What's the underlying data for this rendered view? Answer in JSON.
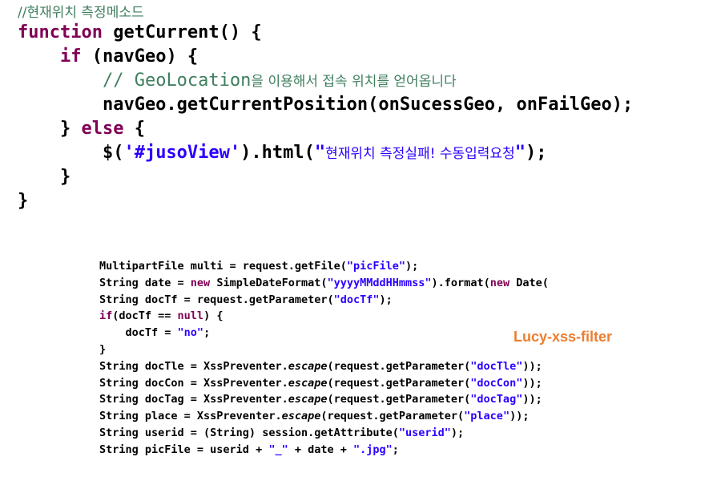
{
  "colors": {
    "keyword": "#7f0055",
    "string": "#2a00ff",
    "comment": "#3f7f5f",
    "plain": "#000000",
    "label": "#ed7d31"
  },
  "geo_code": {
    "lines": [
      [
        {
          "t": "comment",
          "v": "//현재위치 측정메소드"
        }
      ],
      [
        {
          "t": "keyword",
          "v": "function"
        },
        {
          "t": "plain",
          "v": " getCurrent() {"
        }
      ],
      [
        {
          "t": "plain",
          "v": "    "
        },
        {
          "t": "keyword",
          "v": "if"
        },
        {
          "t": "plain",
          "v": " (navGeo) {"
        }
      ],
      [
        {
          "t": "plain",
          "v": "        "
        },
        {
          "t": "comment",
          "v": "// GeoLocation"
        },
        {
          "t": "comment-kr",
          "v": "을 이용해서 접속 위치를 얻어옵니다"
        }
      ],
      [
        {
          "t": "plain",
          "v": "        navGeo.getCurrentPosition(onSucessGeo, onFailGeo);"
        }
      ],
      [
        {
          "t": "plain",
          "v": "    } "
        },
        {
          "t": "keyword",
          "v": "else"
        },
        {
          "t": "plain",
          "v": " {"
        }
      ],
      [
        {
          "t": "plain",
          "v": "        $("
        },
        {
          "t": "string",
          "v": "'#jusoView'"
        },
        {
          "t": "plain",
          "v": ").html("
        },
        {
          "t": "string",
          "v": "\""
        },
        {
          "t": "string-kr",
          "v": "현재위치 측정실패! 수동입력요청"
        },
        {
          "t": "string",
          "v": "\""
        },
        {
          "t": "plain",
          "v": ");"
        }
      ],
      [
        {
          "t": "plain",
          "v": "    }"
        }
      ],
      [
        {
          "t": "plain",
          "v": "}"
        }
      ]
    ]
  },
  "java_code": {
    "lines": [
      [
        {
          "t": "plain",
          "v": "MultipartFile multi = request.getFile("
        },
        {
          "t": "string",
          "v": "\"picFile\""
        },
        {
          "t": "plain",
          "v": ");"
        }
      ],
      [
        {
          "t": "plain",
          "v": "String date = "
        },
        {
          "t": "keyword",
          "v": "new"
        },
        {
          "t": "plain",
          "v": " SimpleDateFormat("
        },
        {
          "t": "string",
          "v": "\"yyyyMMddHHmmss\""
        },
        {
          "t": "plain",
          "v": ").format("
        },
        {
          "t": "keyword",
          "v": "new"
        },
        {
          "t": "plain",
          "v": " Date("
        }
      ],
      [
        {
          "t": "plain",
          "v": "String docTf = request.getParameter("
        },
        {
          "t": "string",
          "v": "\"docTf\""
        },
        {
          "t": "plain",
          "v": ");"
        }
      ],
      [
        {
          "t": "keyword",
          "v": "if"
        },
        {
          "t": "plain",
          "v": "(docTf == "
        },
        {
          "t": "keyword",
          "v": "null"
        },
        {
          "t": "plain",
          "v": ") {"
        }
      ],
      [
        {
          "t": "plain",
          "v": "    docTf = "
        },
        {
          "t": "string",
          "v": "\"no\""
        },
        {
          "t": "plain",
          "v": ";"
        }
      ],
      [
        {
          "t": "plain",
          "v": "}"
        }
      ],
      [
        {
          "t": "plain",
          "v": "String docTle = XssPreventer."
        },
        {
          "t": "italic",
          "v": "escape"
        },
        {
          "t": "plain",
          "v": "(request.getParameter("
        },
        {
          "t": "string",
          "v": "\"docTle\""
        },
        {
          "t": "plain",
          "v": "));"
        }
      ],
      [
        {
          "t": "plain",
          "v": "String docCon = XssPreventer."
        },
        {
          "t": "italic",
          "v": "escape"
        },
        {
          "t": "plain",
          "v": "(request.getParameter("
        },
        {
          "t": "string",
          "v": "\"docCon\""
        },
        {
          "t": "plain",
          "v": "));"
        }
      ],
      [
        {
          "t": "plain",
          "v": "String docTag = XssPreventer."
        },
        {
          "t": "italic",
          "v": "escape"
        },
        {
          "t": "plain",
          "v": "(request.getParameter("
        },
        {
          "t": "string",
          "v": "\"docTag\""
        },
        {
          "t": "plain",
          "v": "));"
        }
      ],
      [
        {
          "t": "plain",
          "v": "String place = XssPreventer."
        },
        {
          "t": "italic",
          "v": "escape"
        },
        {
          "t": "plain",
          "v": "(request.getParameter("
        },
        {
          "t": "string",
          "v": "\"place\""
        },
        {
          "t": "plain",
          "v": "));"
        }
      ],
      [
        {
          "t": "plain",
          "v": "String userid = (String) session.getAttribute("
        },
        {
          "t": "string",
          "v": "\"userid\""
        },
        {
          "t": "plain",
          "v": ");"
        }
      ],
      [
        {
          "t": "plain",
          "v": "String picFile = userid + "
        },
        {
          "t": "string",
          "v": "\"_\""
        },
        {
          "t": "plain",
          "v": " + date + "
        },
        {
          "t": "string",
          "v": "\".jpg\""
        },
        {
          "t": "plain",
          "v": ";"
        }
      ]
    ]
  },
  "annotation": {
    "label": "Lucy-xss-filter"
  }
}
